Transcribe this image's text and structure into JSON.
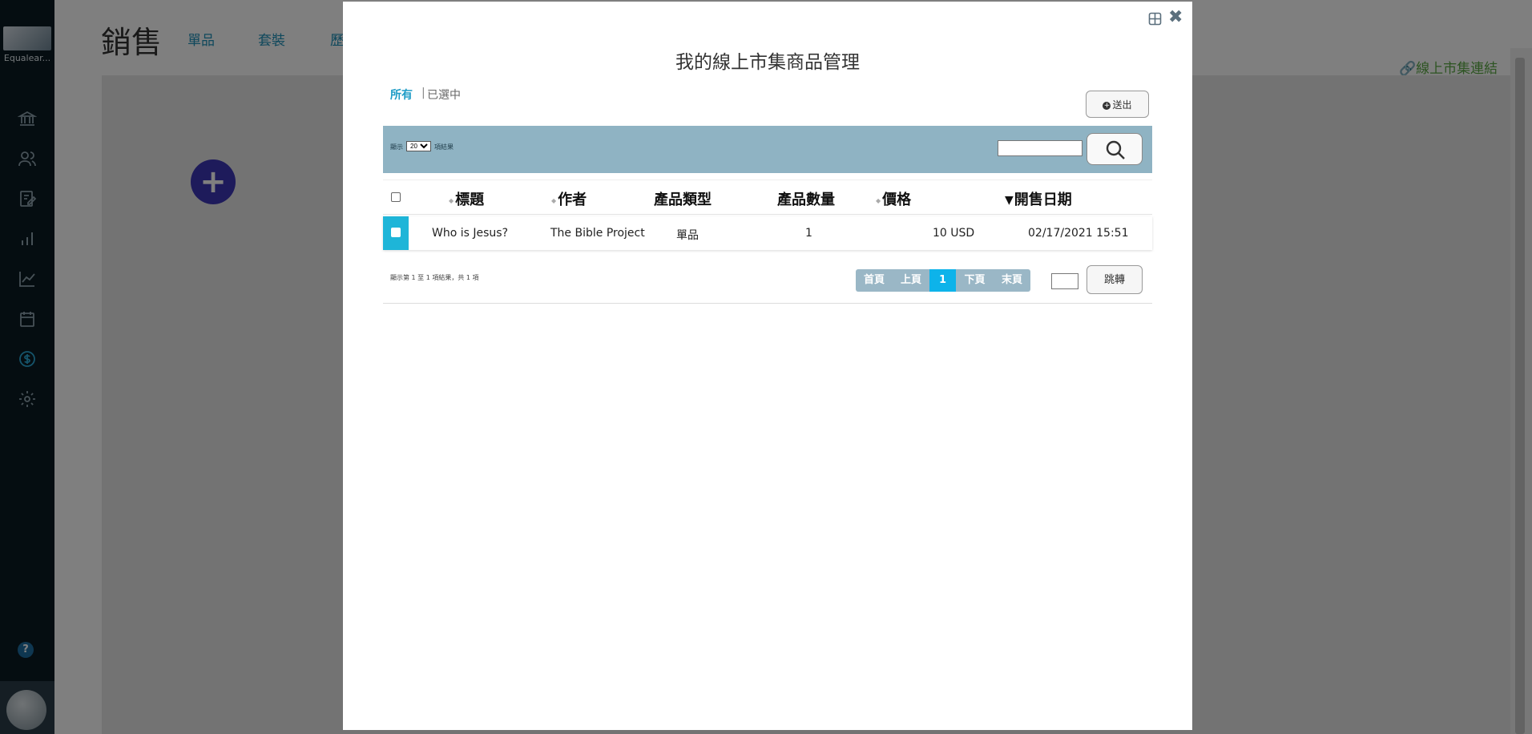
{
  "sidebar": {
    "logo_text": "Equalear...",
    "icons": [
      "bank-icon",
      "users-icon",
      "edit-icon",
      "bar-chart-icon",
      "line-chart-icon",
      "calendar-icon",
      "dollar-icon",
      "gear-icon"
    ],
    "help_label": "?"
  },
  "page": {
    "title": "銷售",
    "tabs": [
      "單品",
      "套裝",
      "歷"
    ],
    "market_link": "線上市集連結"
  },
  "modal": {
    "title": "我的線上市集商品管理",
    "filters": {
      "all": "所有",
      "separator": "|",
      "selected": "已選中"
    },
    "submit_label": "送出",
    "length": {
      "prefix": "顯示",
      "value": "20",
      "options": [
        "20"
      ],
      "suffix": "項結果"
    },
    "search_placeholder": "",
    "columns": [
      "標題",
      "作者",
      "產品類型",
      "產品數量",
      "價格",
      "開售日期"
    ],
    "rows": [
      {
        "title": "Who is Jesus?",
        "author": "The Bible Project",
        "type": "單品",
        "quantity": "1",
        "price": "10 USD",
        "date": "02/17/2021 15:51"
      }
    ],
    "info": "顯示第 1 至 1 項結果，共 1 項",
    "pager": {
      "first": "首頁",
      "prev": "上頁",
      "current": "1",
      "next": "下頁",
      "last": "末頁"
    },
    "jump_label": "跳轉"
  },
  "colors": {
    "accent": "#1e9cc6",
    "toolbar": "#8fb3c3",
    "selected_row": "#1eb5d8",
    "page_active": "#0db3ea",
    "plus_button": "#3d36b7",
    "link_green": "#5aa845"
  }
}
